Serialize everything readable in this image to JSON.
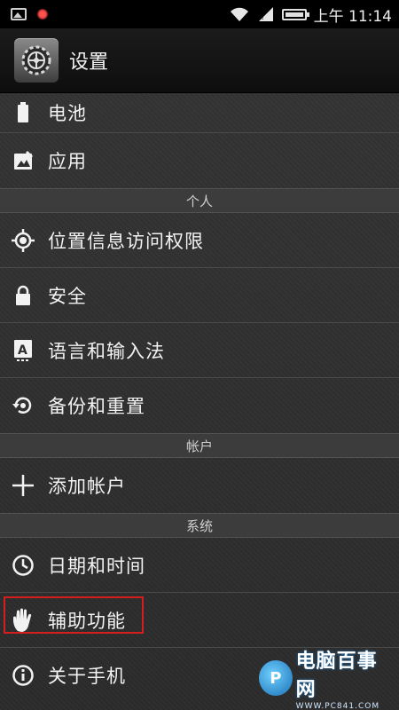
{
  "status_bar": {
    "time": "上午 11:14",
    "icons": [
      "image-icon",
      "record-icon",
      "wifi-icon",
      "signal-icon",
      "battery-icon"
    ]
  },
  "action_bar": {
    "title": "设置",
    "icon": "settings-gear-icon"
  },
  "list": {
    "battery": {
      "label": "电池",
      "icon": "battery-icon"
    },
    "apps": {
      "label": "应用",
      "icon": "apps-icon"
    },
    "section_personal": "个人",
    "location": {
      "label": "位置信息访问权限",
      "icon": "location-icon"
    },
    "security": {
      "label": "安全",
      "icon": "lock-icon"
    },
    "language": {
      "label": "语言和输入法",
      "icon": "keyboard-icon"
    },
    "backup": {
      "label": "备份和重置",
      "icon": "backup-icon"
    },
    "section_accounts": "帐户",
    "add_account": {
      "label": "添加帐户",
      "icon": "plus-icon"
    },
    "section_system": "系统",
    "datetime": {
      "label": "日期和时间",
      "icon": "clock-icon"
    },
    "accessibility": {
      "label": "辅助功能",
      "icon": "hand-icon"
    },
    "about": {
      "label": "关于手机",
      "icon": "info-icon"
    }
  },
  "watermark": {
    "logo_text": "P",
    "name": "电脑百事网",
    "url": "WWW.PC841.COM"
  },
  "colors": {
    "highlight": "#d51f1f",
    "background": "#2e2e2e",
    "header_bg": "#3c3c3c"
  }
}
